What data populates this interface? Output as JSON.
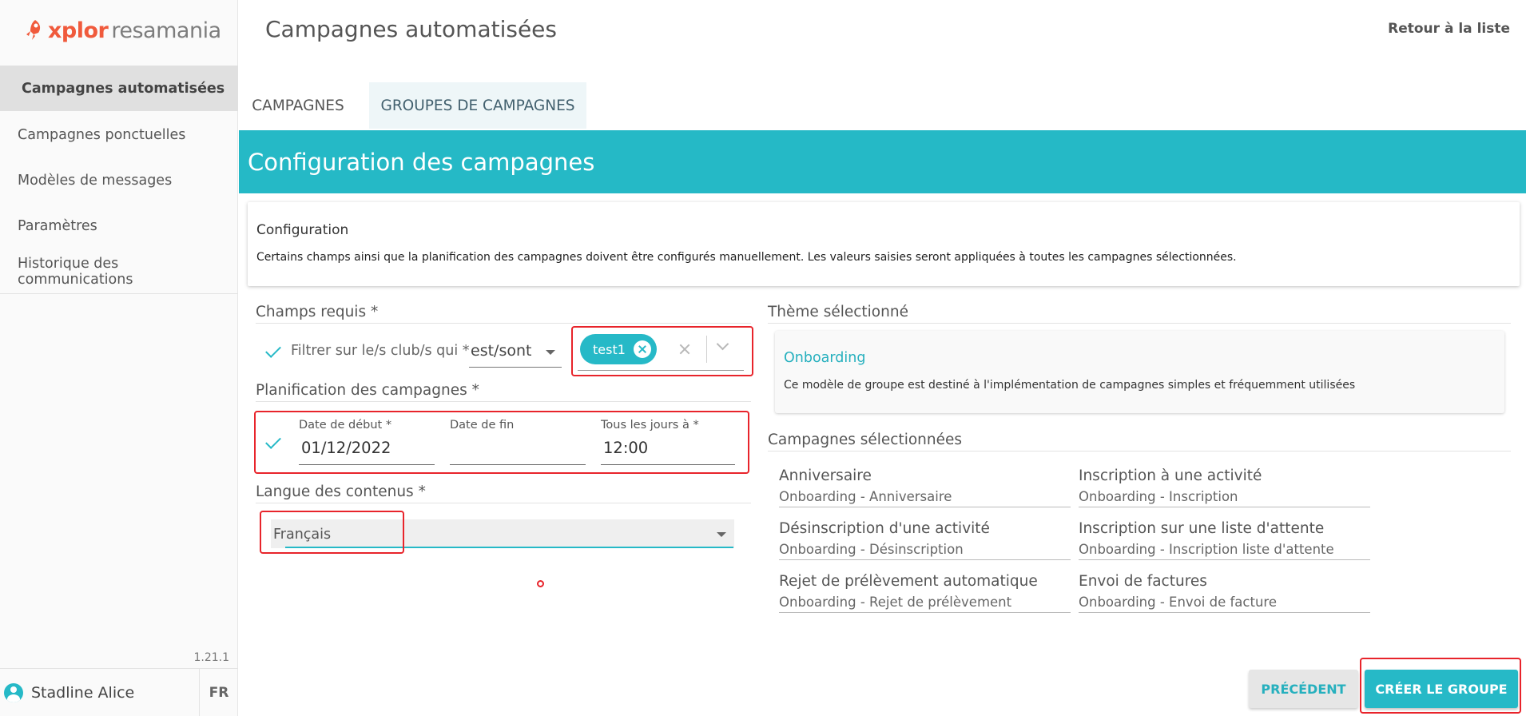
{
  "app": {
    "logo_primary": "xplor",
    "logo_secondary": "resamania",
    "page_title": "Campagnes automatisées",
    "back_link": "Retour à la liste",
    "version": "1.21.1"
  },
  "sidebar": {
    "items": [
      {
        "label": "Campagnes automatisées",
        "active": true
      },
      {
        "label": "Campagnes ponctuelles",
        "active": false
      },
      {
        "label": "Modèles de messages",
        "active": false
      },
      {
        "label": "Paramètres",
        "active": false
      },
      {
        "label": "Historique des communications",
        "active": false
      }
    ],
    "user_name": "Stadline Alice",
    "language": "FR"
  },
  "tabs": [
    {
      "label": "CAMPAGNES",
      "selected": false
    },
    {
      "label": "GROUPES DE CAMPAGNES",
      "selected": true
    }
  ],
  "banner": {
    "title": "Configuration des campagnes"
  },
  "config_card": {
    "title": "Configuration",
    "description": "Certains champs ainsi que la planification des campagnes doivent être configurés manuellement. Les valeurs saisies seront appliquées à toutes les campagnes sélectionnées."
  },
  "required_fields": {
    "heading": "Champs requis *",
    "filter_label": "Filtrer sur le/s club/s qui *",
    "operator_value": "est/sont",
    "clubs": [
      "test1"
    ]
  },
  "schedule": {
    "heading": "Planification des campagnes *",
    "start_label": "Date de début *",
    "start_value": "01/12/2022",
    "end_label": "Date de fin",
    "end_value": "",
    "daily_label": "Tous les jours à *",
    "daily_value": "12:00"
  },
  "content_language": {
    "heading": "Langue des contenus *",
    "value": "Français"
  },
  "theme": {
    "heading": "Thème sélectionné",
    "name": "Onboarding",
    "description": "Ce modèle de groupe est destiné à l'implémentation de campagnes simples et fréquemment utilisées"
  },
  "selected_campaigns": {
    "heading": "Campagnes sélectionnées",
    "items": [
      {
        "title": "Anniversaire",
        "template": "Onboarding - Anniversaire"
      },
      {
        "title": "Inscription à une activité",
        "template": "Onboarding - Inscription"
      },
      {
        "title": "Désinscription d'une activité",
        "template": "Onboarding - Désinscription"
      },
      {
        "title": "Inscription sur une liste d'attente",
        "template": "Onboarding - Inscription liste d'attente"
      },
      {
        "title": "Rejet de prélèvement automatique",
        "template": "Onboarding - Rejet de prélèvement"
      },
      {
        "title": "Envoi de factures",
        "template": "Onboarding - Envoi de facture"
      }
    ]
  },
  "actions": {
    "previous": "PRÉCÉDENT",
    "create": "CRÉER LE GROUPE"
  },
  "colors": {
    "accent": "#26b9c7",
    "brand": "#f05a3c",
    "annotation": "#e8242b"
  }
}
